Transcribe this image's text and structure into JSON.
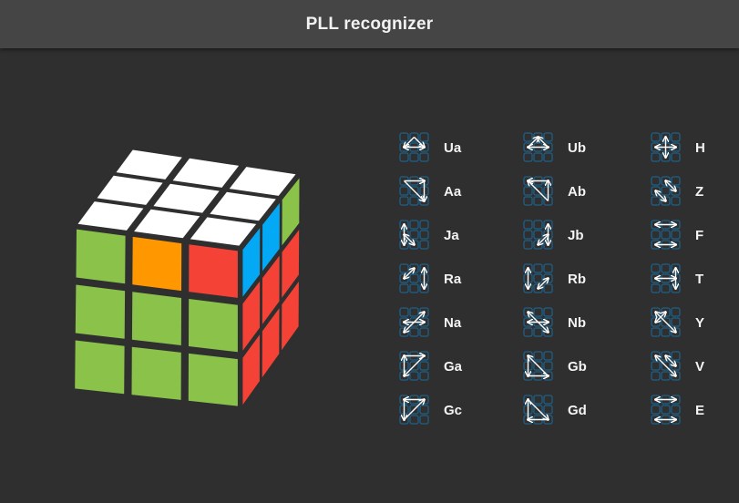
{
  "app": {
    "title": "PLL recognizer"
  },
  "colors": {
    "background": "#2f2f2f",
    "titlebar": "#454545",
    "white": "#ffffff",
    "green": "#8bc34a",
    "orange": "#ff9800",
    "red": "#f44336",
    "blue": "#03a9f4",
    "sticker_gap": "#2f2f2f",
    "icon_tile": "#1f5f86",
    "icon_arrow": "#ffffff"
  },
  "cube": {
    "top_face": [
      "white",
      "white",
      "white",
      "white",
      "white",
      "white",
      "white",
      "white",
      "white"
    ],
    "front_face": [
      "green",
      "orange",
      "red",
      "green",
      "green",
      "green",
      "green",
      "green",
      "green"
    ],
    "right_face": [
      "blue",
      "blue",
      "green",
      "red",
      "red",
      "red",
      "red",
      "red",
      "red"
    ]
  },
  "pll": {
    "items": [
      {
        "name": "Ua",
        "icon": "pll-ua-icon"
      },
      {
        "name": "Ub",
        "icon": "pll-ub-icon"
      },
      {
        "name": "H",
        "icon": "pll-h-icon"
      },
      {
        "name": "Aa",
        "icon": "pll-aa-icon"
      },
      {
        "name": "Ab",
        "icon": "pll-ab-icon"
      },
      {
        "name": "Z",
        "icon": "pll-z-icon"
      },
      {
        "name": "Ja",
        "icon": "pll-ja-icon"
      },
      {
        "name": "Jb",
        "icon": "pll-jb-icon"
      },
      {
        "name": "F",
        "icon": "pll-f-icon"
      },
      {
        "name": "Ra",
        "icon": "pll-ra-icon"
      },
      {
        "name": "Rb",
        "icon": "pll-rb-icon"
      },
      {
        "name": "T",
        "icon": "pll-t-icon"
      },
      {
        "name": "Na",
        "icon": "pll-na-icon"
      },
      {
        "name": "Nb",
        "icon": "pll-nb-icon"
      },
      {
        "name": "Y",
        "icon": "pll-y-icon"
      },
      {
        "name": "Ga",
        "icon": "pll-ga-icon"
      },
      {
        "name": "Gb",
        "icon": "pll-gb-icon"
      },
      {
        "name": "V",
        "icon": "pll-v-icon"
      },
      {
        "name": "Gc",
        "icon": "pll-gc-icon"
      },
      {
        "name": "Gd",
        "icon": "pll-gd-icon"
      },
      {
        "name": "E",
        "icon": "pll-e-icon"
      }
    ]
  }
}
